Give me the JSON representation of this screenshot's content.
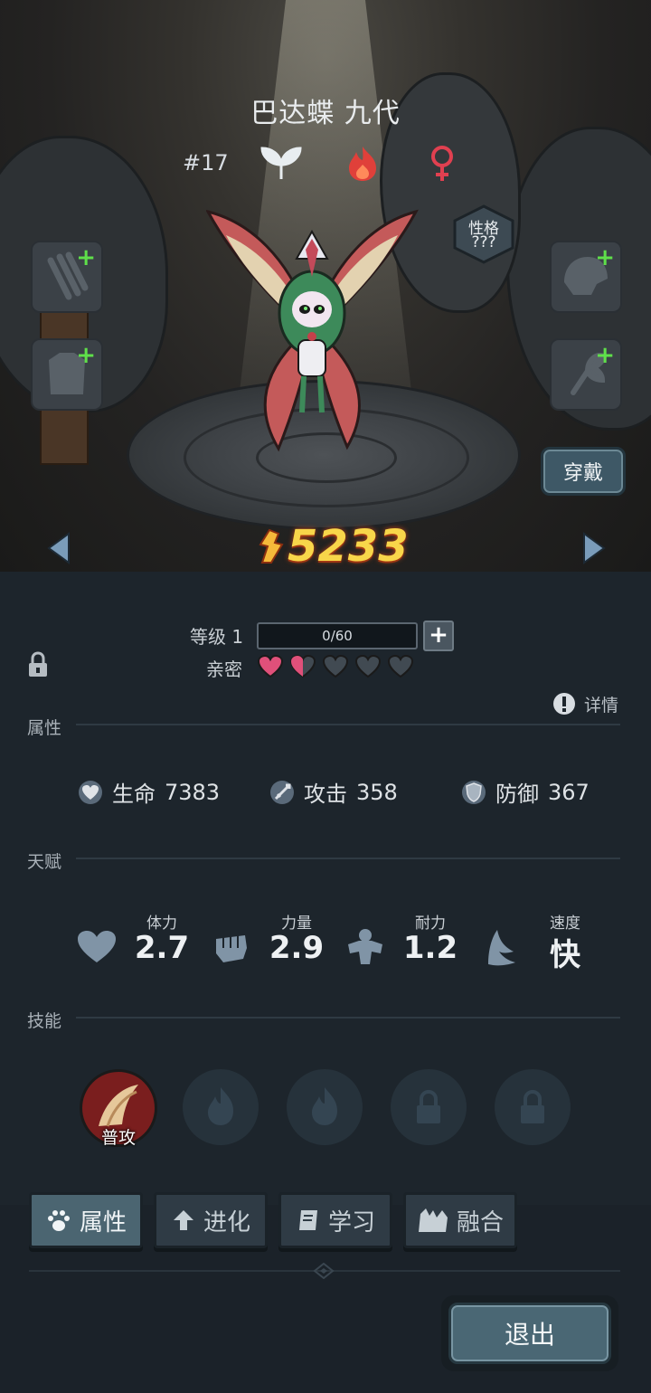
{
  "pet": {
    "name": "巴达蝶 九代",
    "number": "#17"
  },
  "badges": [
    {
      "name": "leaf-element-icon",
      "color": "#e8edf0"
    },
    {
      "name": "fire-element-icon",
      "color": "#e0403a"
    },
    {
      "name": "female-icon",
      "color": "#e04050"
    }
  ],
  "personality": {
    "label": "性格",
    "value": "???"
  },
  "equip_slots": [
    {
      "icon": "weapon-claw-icon",
      "plus": "+"
    },
    {
      "icon": "armor-icon",
      "plus": "+"
    },
    {
      "icon": "helmet-icon",
      "plus": "+"
    },
    {
      "icon": "accessory-icon",
      "plus": "+"
    }
  ],
  "wear_button": "穿戴",
  "combat_power": "5233",
  "level": {
    "label": "等级 1",
    "progress_text": "0/60",
    "add": "+"
  },
  "intimacy": {
    "label": "亲密",
    "hearts_filled": 1.5,
    "hearts_total": 5,
    "heart_color": "#e0507a"
  },
  "details_label": "详情",
  "sections": {
    "attributes": "属性",
    "talent": "天赋",
    "skills": "技能"
  },
  "stats": [
    {
      "icon": "heart-shield-icon",
      "label": "生命",
      "value": "7383"
    },
    {
      "icon": "sword-icon",
      "label": "攻击",
      "value": "358"
    },
    {
      "icon": "shield-icon",
      "label": "防御",
      "value": "367"
    }
  ],
  "talents": [
    {
      "icon": "heart-icon",
      "label": "体力",
      "value": "2.7"
    },
    {
      "icon": "fist-icon",
      "label": "力量",
      "value": "2.9"
    },
    {
      "icon": "muscle-icon",
      "label": "耐力",
      "value": "1.2"
    },
    {
      "icon": "wing-icon",
      "label": "速度",
      "value": "快"
    }
  ],
  "skills": [
    {
      "state": "normal-attack",
      "label": "普攻"
    },
    {
      "state": "empty-flame",
      "label": ""
    },
    {
      "state": "empty-flame",
      "label": ""
    },
    {
      "state": "locked",
      "label": ""
    },
    {
      "state": "locked",
      "label": ""
    }
  ],
  "tabs": [
    {
      "label": "属性",
      "icon": "paw-icon",
      "active": true
    },
    {
      "label": "进化",
      "icon": "evolve-arrow-icon",
      "active": false
    },
    {
      "label": "学习",
      "icon": "book-icon",
      "active": false
    },
    {
      "label": "融合",
      "icon": "fusion-icon",
      "active": false
    }
  ],
  "exit_button": "退出"
}
